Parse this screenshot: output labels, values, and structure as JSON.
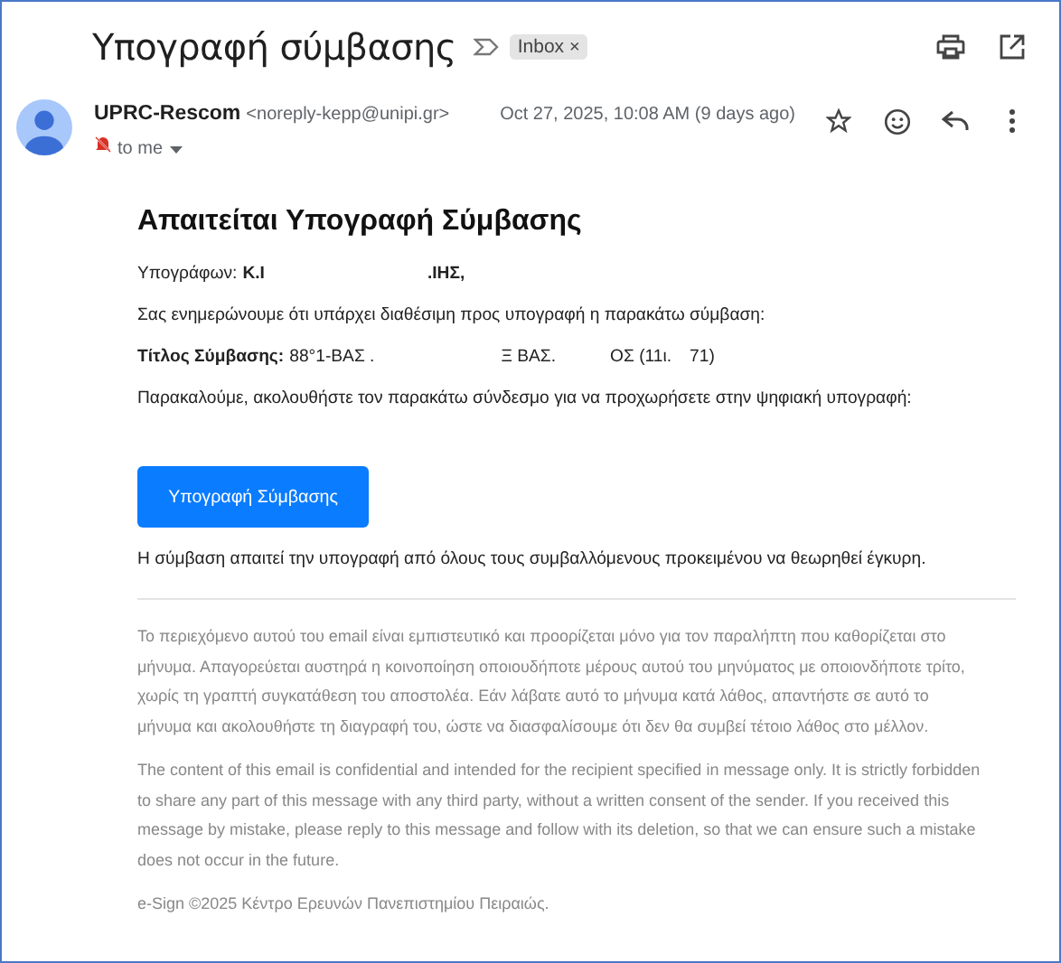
{
  "subject": "Υπογραφή σύμβασης",
  "label": {
    "text": "Inbox",
    "remove": "×"
  },
  "sender": {
    "name": "UPRC-Rescom",
    "email": "<noreply-kepp@unipi.gr>",
    "recipient": "to me",
    "date": "Oct 27, 2025, 10:08 AM (9 days ago)",
    "starred": false
  },
  "body": {
    "heading": "Απαιτείται Υπογραφή Σύμβασης",
    "signer": {
      "label": "Υπογράφων:",
      "parts": [
        "Κ.Ι",
        ".ΙΗΣ,"
      ]
    },
    "intro": "Σας ενημερώνουμε ότι υπάρχει διαθέσιμη προς υπογραφή η παρακάτω σύμβαση:",
    "contract": {
      "label": "Τίτλος Σύμβασης:",
      "parts": [
        "88°1-ΒΑΣ .",
        "Ξ ΒΑΣ.",
        "ΟΣ (11ι.",
        "71)"
      ]
    },
    "instruction": "Παρακαλούμε, ακολουθήστε τον παρακάτω σύνδεσμο για να προχωρήσετε στην ψηφιακή υπογραφή:",
    "button": "Υπογραφή Σύμβασης",
    "note": "Η σύμβαση απαιτεί την υπογραφή από όλους τους συμβαλλόμενους προκειμένου να θεωρηθεί έγκυρη.",
    "disclaimers": [
      "Το περιεχόμενο αυτού του email είναι εμπιστευτικό και προορίζεται μόνο για τον παραλήπτη που καθορίζεται στο μήνυμα. Απαγορεύεται αυστηρά η κοινοποίηση οποιουδήποτε μέρους αυτού του μηνύματος με οποιονδήποτε τρίτο, χωρίς τη γραπτή συγκατάθεση του αποστολέα. Εάν λάβατε αυτό το μήνυμα κατά λάθος, απαντήστε σε αυτό το μήνυμα και ακολουθήστε τη διαγραφή του, ώστε να διασφαλίσουμε ότι δεν θα συμβεί τέτοιο λάθος στο μέλλον.",
      "The content of this email is confidential and intended for the recipient specified in message only. It is strictly forbidden to share any part of this message with any third party, without a written consent of the sender. If you received this message by mistake, please reply to this message and follow with its deletion, so that we can ensure such a mistake does not occur in the future."
    ],
    "footer": "e-Sign ©2025 Κέντρο Ερευνών Πανεπιστημίου Πειραιώς."
  }
}
